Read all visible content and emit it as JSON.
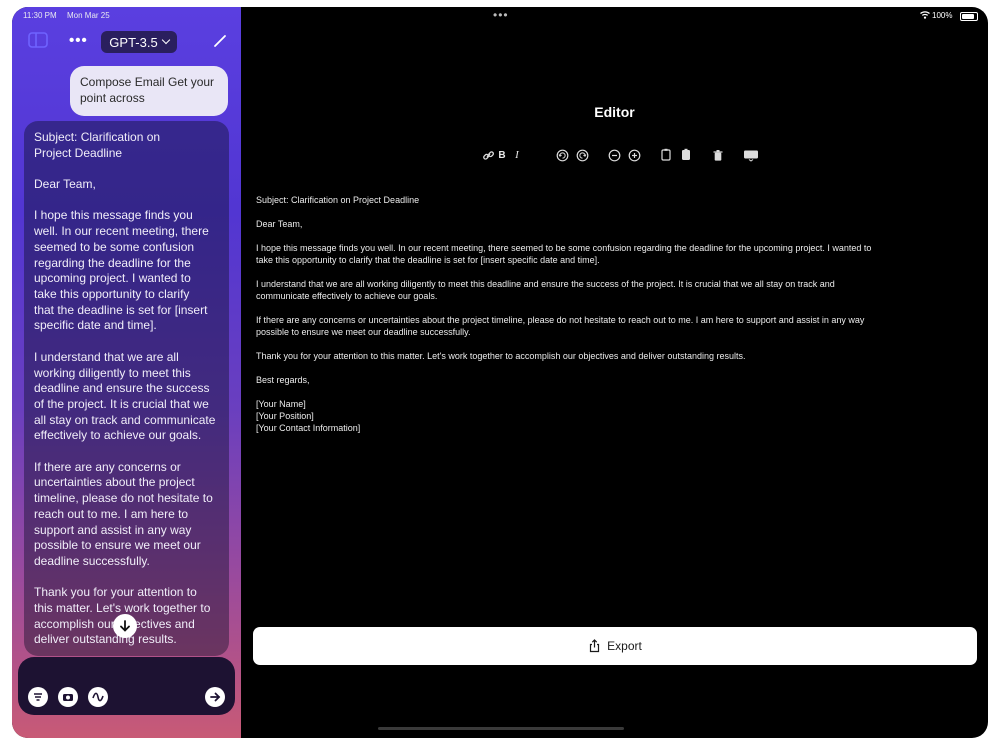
{
  "status_bar": {
    "time": "11:30 PM",
    "date": "Mon Mar 25",
    "battery": "100%"
  },
  "sidebar": {
    "model": "GPT-3.5",
    "user_message": "Compose Email Get your point across",
    "assistant_paragraphs": [
      "Subject: Clarification on\nProject Deadline",
      "Dear Team,",
      "I hope this message finds you\nwell. In our recent meeting, there\nseemed to be some confusion\nregarding the deadline for the\nupcoming project. I wanted to\ntake this opportunity to clarify\nthat the deadline is set for [insert\nspecific date and time].",
      "I understand that we are all\nworking diligently to meet this\ndeadline and ensure the success\nof the project. It is crucial that we\nall stay on track and communicate\neffectively to achieve our goals.",
      "If there are any concerns or\nuncertainties about the project\ntimeline, please do not hesitate to\nreach out to me. I am here to\nsupport and assist in any way\npossible to ensure we meet our\ndeadline successfully.",
      "Thank you for your attention to\nthis matter. Let's work together to\naccomplish our objectives and\ndeliver outstanding results."
    ]
  },
  "editor": {
    "title": "Editor",
    "paragraphs": [
      "Subject: Clarification on Project Deadline",
      "Dear Team,",
      "I hope this message finds you well. In our recent meeting, there seemed to be some confusion regarding the deadline for the upcoming project. I wanted to\ntake this opportunity to clarify that the deadline is set for [insert specific date and time].",
      "I understand that we are all working diligently to meet this deadline and ensure the success of the project. It is crucial that we all stay on track and\ncommunicate effectively to achieve our goals.",
      "If there are any concerns or uncertainties about the project timeline, please do not hesitate to reach out to me. I am here to support and assist in any way\npossible to ensure we meet our deadline successfully.",
      "Thank you for your attention to this matter. Let's work together to accomplish our objectives and deliver outstanding results.",
      "Best regards,",
      "[Your Name]\n[Your Position]\n[Your Contact Information]"
    ],
    "toolbar": {
      "bold": "B",
      "italic": "I"
    },
    "export_label": "Export"
  },
  "icons": {
    "toolbar": [
      "link-icon",
      "bold-icon",
      "italic-icon",
      "undo-icon",
      "redo-icon",
      "zoom-out-icon",
      "zoom-in-icon",
      "copy-icon",
      "paste-icon",
      "trash-icon",
      "keyboard-icon"
    ],
    "composer": [
      "filter-icon",
      "camera-icon",
      "waveform-icon",
      "send-arrow-icon"
    ]
  },
  "colors": {
    "sidebar_top": "#5a3fe0",
    "sidebar_bottom": "#c85a76",
    "editor_bg": "#000000",
    "model_pill": "#2a1f5e"
  }
}
